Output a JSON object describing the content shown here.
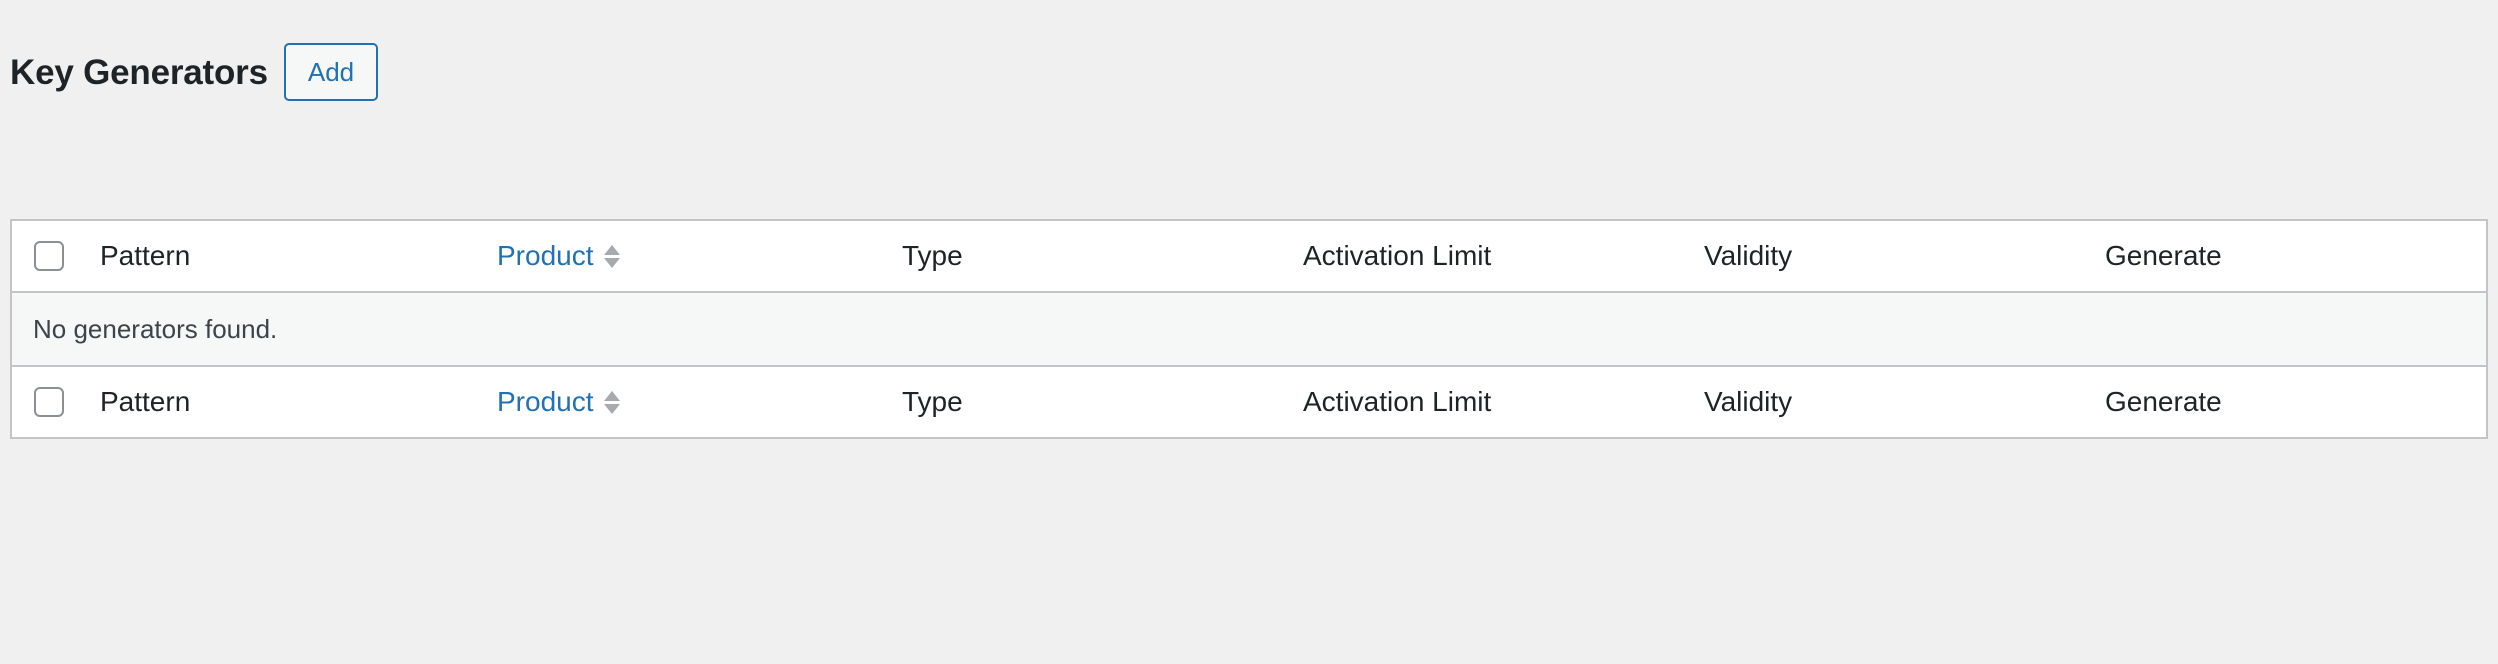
{
  "page": {
    "title": "Key Generators",
    "add_label": "Add"
  },
  "table": {
    "columns": {
      "pattern": "Pattern",
      "product": "Product",
      "type": "Type",
      "activation_limit": "Activation Limit",
      "validity": "Validity",
      "generate": "Generate"
    },
    "empty_message": "No generators found."
  },
  "colors": {
    "background": "#f0f0f1",
    "accent": "#2271b1",
    "border": "#c3c4c7",
    "text": "#1d2327"
  },
  "icons": {
    "sort": "sort-arrows-icon"
  }
}
